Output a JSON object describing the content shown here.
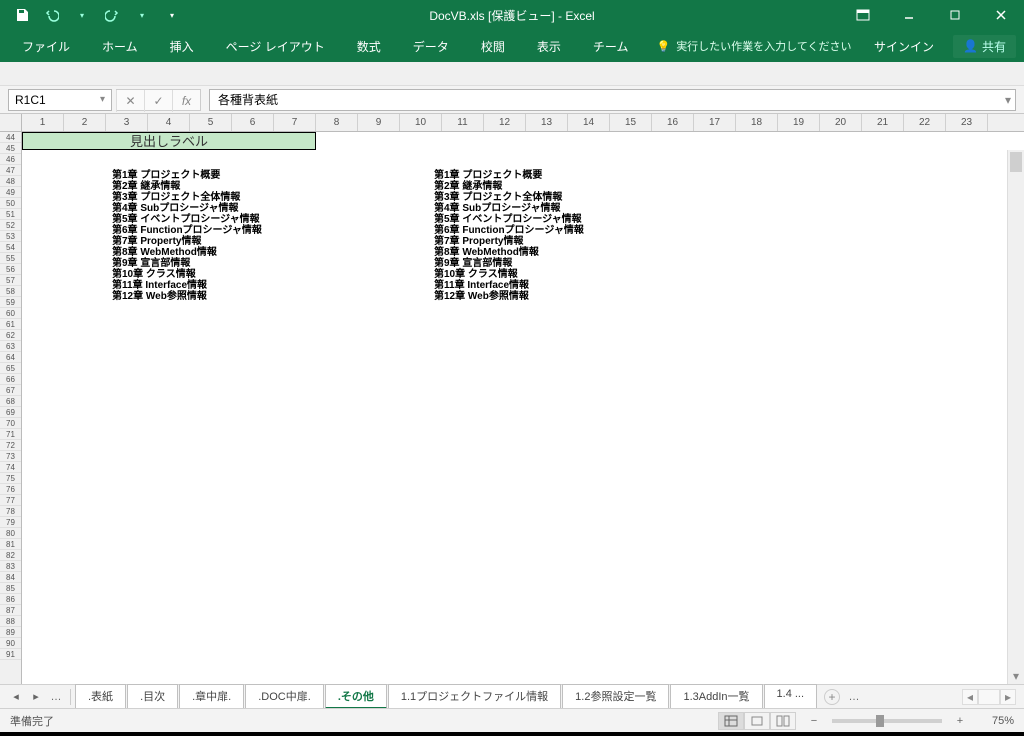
{
  "title": "DocVB.xls [保護ビュー] - Excel",
  "qat": {
    "save": "保存",
    "undo": "元に戻す",
    "redo": "やり直し",
    "cust": "カスタマイズ"
  },
  "ribbon": {
    "tabs": [
      "ファイル",
      "ホーム",
      "挿入",
      "ページ レイアウト",
      "数式",
      "データ",
      "校閲",
      "表示",
      "チーム"
    ],
    "tell_me": "実行したい作業を入力してください",
    "signin": "サインイン",
    "share": "共有"
  },
  "namebox": "R1C1",
  "formula_value": "各種背表紙",
  "col_numbers": [
    "1",
    "2",
    "3",
    "4",
    "5",
    "6",
    "7",
    "8",
    "9",
    "10",
    "11",
    "12",
    "13",
    "14",
    "15",
    "16",
    "17",
    "18",
    "19",
    "20",
    "21",
    "22",
    "23"
  ],
  "row_numbers": [
    "44",
    "45",
    "46",
    "47",
    "48",
    "49",
    "50",
    "51",
    "52",
    "53",
    "54",
    "55",
    "56",
    "57",
    "58",
    "59",
    "60",
    "61",
    "62",
    "63",
    "64",
    "65",
    "66",
    "67",
    "68",
    "69",
    "70",
    "71",
    "72",
    "73",
    "74",
    "75",
    "76",
    "77",
    "78",
    "79",
    "80",
    "81",
    "82",
    "83",
    "84",
    "85",
    "86",
    "87",
    "88",
    "89",
    "90",
    "91"
  ],
  "green_label": "見出しラベル",
  "chapters": [
    "第1章 プロジェクト概要",
    "第2章 継承情報",
    "第3章 プロジェクト全体情報",
    "第4章 Subプロシージャ情報",
    "第5章 イベントプロシージャ情報",
    "第6章 Functionプロシージャ情報",
    "第7章 Property情報",
    "第8章 WebMethod情報",
    "第9章 宣言部情報",
    "第10章 クラス情報",
    "第11章 Interface情報",
    "第12章 Web参照情報"
  ],
  "sheet_tabs": {
    "items": [
      ".表紙",
      ".目次",
      ".章中扉.",
      ".DOC中扉.",
      ".その他",
      "1.1プロジェクトファイル情報",
      "1.2参照設定一覧",
      "1.3AddIn一覧",
      "1.4 ..."
    ],
    "active_index": 4
  },
  "status": {
    "ready": "準備完了",
    "zoom": "75%"
  }
}
